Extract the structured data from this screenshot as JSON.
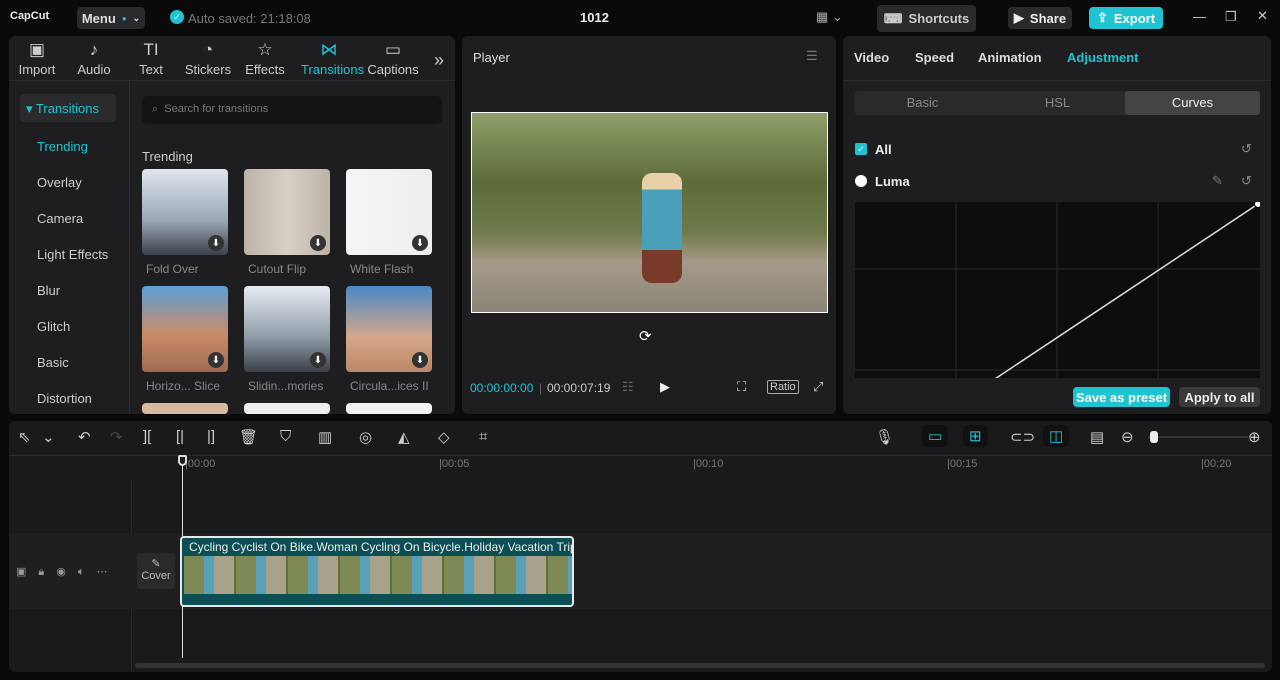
{
  "app": {
    "logo": "CapCut",
    "menu": "Menu",
    "autosave": "Auto saved: 21:18:08",
    "project": "1012",
    "shortcuts": "Shortcuts",
    "share": "Share",
    "export": "Export"
  },
  "media_tabs": [
    {
      "label": "Import",
      "icon": "▣"
    },
    {
      "label": "Audio",
      "icon": "♪"
    },
    {
      "label": "Text",
      "icon": "TI"
    },
    {
      "label": "Stickers",
      "icon": "◔"
    },
    {
      "label": "Effects",
      "icon": "☆"
    },
    {
      "label": "Transitions",
      "icon": "⋈"
    },
    {
      "label": "Captions",
      "icon": "▭"
    }
  ],
  "transitions": {
    "header": "Transitions",
    "search_placeholder": "Search for transitions",
    "section": "Trending",
    "categories": [
      "Trending",
      "Overlay",
      "Camera",
      "Light Effects",
      "Blur",
      "Glitch",
      "Basic",
      "Distortion"
    ],
    "items": [
      "Fold Over",
      "Cutout Flip",
      "White Flash",
      "Horizo... Slice",
      "Slidin...mories",
      "Circula...ices II"
    ]
  },
  "player": {
    "title": "Player",
    "current": "00:00:00:00",
    "total": "00:00:07:19",
    "ratio": "Ratio"
  },
  "inspector": {
    "tabs": [
      "Video",
      "Speed",
      "Animation",
      "Adjustment"
    ],
    "subtabs": [
      "Basic",
      "HSL",
      "Curves"
    ],
    "all": "All",
    "luma": "Luma",
    "save_preset": "Save as preset",
    "apply_all": "Apply to all",
    "accent": "#1fc4d2"
  },
  "timeline": {
    "ticks": [
      "00:00",
      "00:05",
      "00:10",
      "00:15",
      "00:20"
    ],
    "clip_title": "Cycling Cyclist On Bike.Woman Cycling On Bicycle.Holiday Vacation Trip",
    "cover": "Cover"
  }
}
